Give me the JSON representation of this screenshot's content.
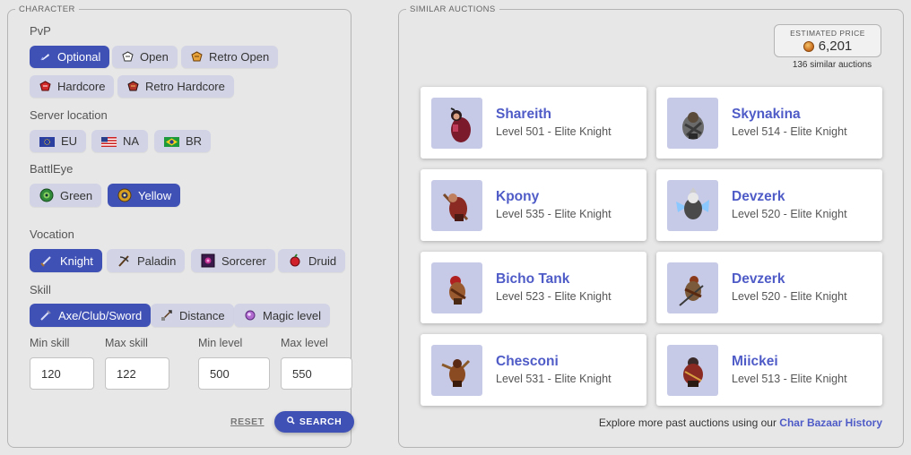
{
  "character": {
    "legend": "CHARACTER",
    "pvp_label": "PvP",
    "pvp": [
      {
        "label": "Optional",
        "icon": "optional-pvp-icon",
        "selected": true
      },
      {
        "label": "Open",
        "icon": "open-pvp-icon",
        "selected": false
      },
      {
        "label": "Retro Open",
        "icon": "retro-open-pvp-icon",
        "selected": false
      },
      {
        "label": "Hardcore",
        "icon": "hardcore-pvp-icon",
        "selected": false
      },
      {
        "label": "Retro Hardcore",
        "icon": "retro-hardcore-pvp-icon",
        "selected": false
      }
    ],
    "location_label": "Server location",
    "locations": [
      {
        "label": "EU",
        "icon": "eu-flag-icon",
        "selected": false
      },
      {
        "label": "NA",
        "icon": "us-flag-icon",
        "selected": false
      },
      {
        "label": "BR",
        "icon": "brazil-flag-icon",
        "selected": false
      }
    ],
    "battleye_label": "BattlEye",
    "battleye": [
      {
        "label": "Green",
        "icon": "green-battleye-icon",
        "selected": false
      },
      {
        "label": "Yellow",
        "icon": "yellow-battleye-icon",
        "selected": true
      }
    ],
    "vocation_label": "Vocation",
    "vocations": [
      {
        "label": "Knight",
        "icon": "sword-icon",
        "selected": true
      },
      {
        "label": "Paladin",
        "icon": "crossbow-icon",
        "selected": false
      },
      {
        "label": "Sorcerer",
        "icon": "sorcerer-icon",
        "selected": false
      },
      {
        "label": "Druid",
        "icon": "druid-icon",
        "selected": false
      }
    ],
    "skill_label": "Skill",
    "skills": [
      {
        "label": "Axe/Club/Sword",
        "icon": "melee-skill-icon",
        "selected": true
      },
      {
        "label": "Distance",
        "icon": "distance-skill-icon",
        "selected": false
      },
      {
        "label": "Magic level",
        "icon": "magic-skill-icon",
        "selected": false
      }
    ],
    "min_skill_label": "Min skill",
    "min_skill": "120",
    "max_skill_label": "Max skill",
    "max_skill": "122",
    "min_level_label": "Min level",
    "min_level": "500",
    "max_level_label": "Max level",
    "max_level": "550",
    "reset_label": "RESET",
    "search_label": "SEARCH"
  },
  "auctions": {
    "legend": "SIMILAR AUCTIONS",
    "estimated_caption": "ESTIMATED PRICE",
    "estimated_price": "6,201",
    "similar_count": "136 similar auctions",
    "cards": [
      {
        "name": "Shareith",
        "level": "Level 501 - Elite Knight"
      },
      {
        "name": "Skynakina",
        "level": "Level 514 - Elite Knight"
      },
      {
        "name": "Kpony",
        "level": "Level 535 - Elite Knight"
      },
      {
        "name": "Devzerk",
        "level": "Level 520 - Elite Knight"
      },
      {
        "name": "Bicho Tank",
        "level": "Level 523 - Elite Knight"
      },
      {
        "name": "Devzerk",
        "level": "Level 520 - Elite Knight"
      },
      {
        "name": "Chesconi",
        "level": "Level 531 - Elite Knight"
      },
      {
        "name": "Miickei",
        "level": "Level 513 - Elite Knight"
      }
    ],
    "explore_text": "Explore more past auctions using our ",
    "explore_link": "Char Bazaar History"
  },
  "colors": {
    "accent": "#3f51b5",
    "chip": "#d2d4e6",
    "link": "#4f5cc7",
    "avatar_bg": "#c7cae6"
  }
}
